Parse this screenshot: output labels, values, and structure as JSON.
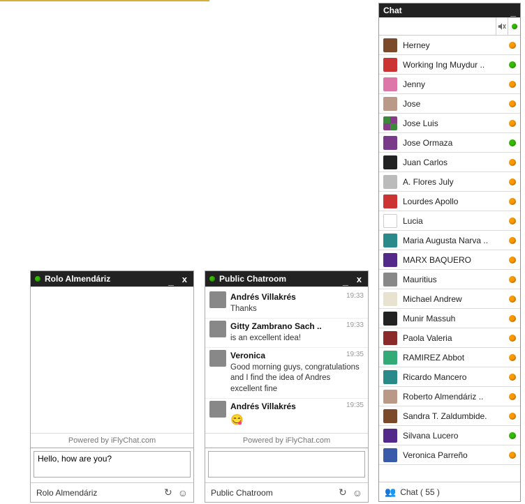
{
  "powered_by": "Powered by iFlyChat.com",
  "window1": {
    "title": "Rolo Almendáriz",
    "status": "green",
    "input_value": "Hello, how are you?",
    "footer_name": "Rolo Almendáriz"
  },
  "window2": {
    "title": "Public Chatroom",
    "status": "green",
    "input_value": "",
    "footer_name": "Public Chatroom",
    "messages": [
      {
        "sender": "Andrés Villakrés",
        "time": "19:33",
        "text": "Thanks",
        "avatar": "av-orange"
      },
      {
        "sender": "Gitty Zambrano Sach ..",
        "time": "19:33",
        "text": "is an excellent idea!",
        "avatar": "av-gray"
      },
      {
        "sender": "Veronica",
        "time": "19:35",
        "text": "Good morning guys, congratulations and I find the idea of Andres excellent fine",
        "avatar": "av-black"
      },
      {
        "sender": "Andrés Villakrés",
        "time": "19:35",
        "text": "😋",
        "avatar": "av-orange",
        "emoji": true
      }
    ]
  },
  "roster": {
    "header": "Chat",
    "search_placeholder": "",
    "my_status": "green",
    "footer_label": "Chat ( 55 )",
    "users": [
      {
        "name": "Herney",
        "status": "orange",
        "avatar": "av-brown"
      },
      {
        "name": "Working Ing Muydur ..",
        "status": "green",
        "avatar": "av-red"
      },
      {
        "name": "Jenny",
        "status": "orange",
        "avatar": "av-pink"
      },
      {
        "name": "Jose",
        "status": "orange",
        "avatar": "av-tan"
      },
      {
        "name": "Jose Luis",
        "status": "orange",
        "avatar": "av-pixel"
      },
      {
        "name": "Jose Ormaza",
        "status": "green",
        "avatar": "av-purple"
      },
      {
        "name": "Juan Carlos",
        "status": "orange",
        "avatar": "av-black"
      },
      {
        "name": "A. Flores July",
        "status": "orange",
        "avatar": "av-lgray"
      },
      {
        "name": "Lourdes Apollo",
        "status": "orange",
        "avatar": "av-red"
      },
      {
        "name": "Lucia",
        "status": "orange",
        "avatar": "av-white"
      },
      {
        "name": "Maria Augusta Narva ..",
        "status": "orange",
        "avatar": "av-teal"
      },
      {
        "name": "MARX BAQUERO",
        "status": "orange",
        "avatar": "av-dpurple"
      },
      {
        "name": "Mauritius",
        "status": "orange",
        "avatar": "av-gray"
      },
      {
        "name": "Michael Andrew",
        "status": "orange",
        "avatar": "av-beige"
      },
      {
        "name": "Munir Massuh",
        "status": "orange",
        "avatar": "av-black"
      },
      {
        "name": "Paola Valeria",
        "status": "orange",
        "avatar": "av-dred"
      },
      {
        "name": "RAMIREZ Abbot",
        "status": "orange",
        "avatar": "av-green"
      },
      {
        "name": "Ricardo Mancero",
        "status": "orange",
        "avatar": "av-teal"
      },
      {
        "name": "Roberto Almendáriz ..",
        "status": "orange",
        "avatar": "av-tan"
      },
      {
        "name": "Sandra T. Zaldumbide.",
        "status": "orange",
        "avatar": "av-brown"
      },
      {
        "name": "Silvana Lucero",
        "status": "green",
        "avatar": "av-dpurple"
      },
      {
        "name": "Veronica Parreño",
        "status": "orange",
        "avatar": "av-blue"
      }
    ]
  }
}
